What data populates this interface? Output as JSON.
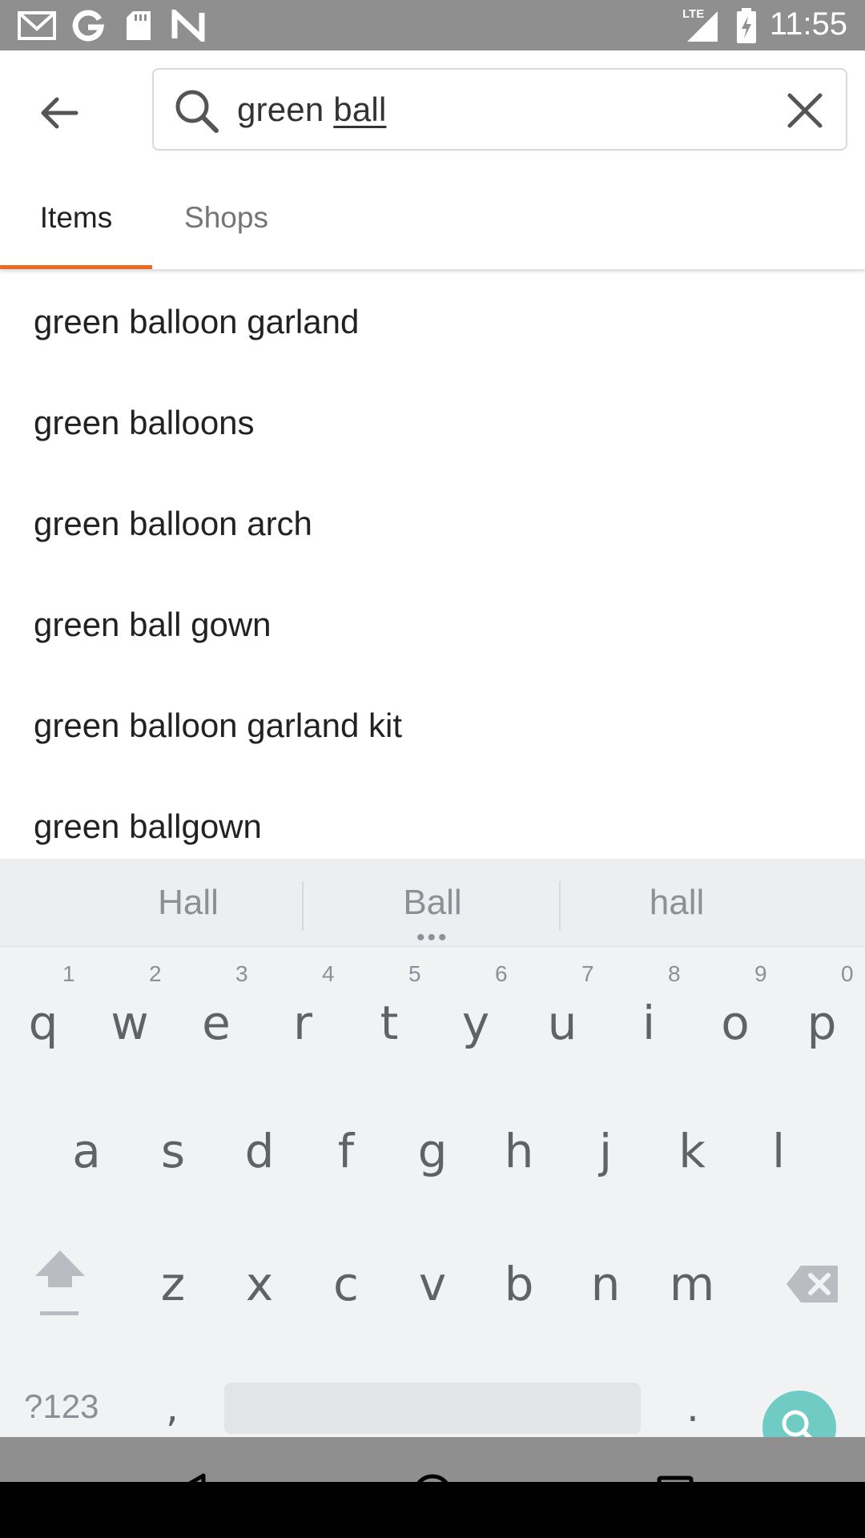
{
  "status_bar": {
    "time": "11:55",
    "network": "LTE",
    "left_icons": [
      "gmail-icon",
      "google-icon",
      "sd-card-icon",
      "n-app-icon"
    ],
    "right_icons": [
      "signal-icon",
      "battery-charging-icon"
    ]
  },
  "search": {
    "prefix": "green ",
    "typed_word": "ball"
  },
  "tabs": [
    {
      "label": "Items",
      "selected": true
    },
    {
      "label": "Shops",
      "selected": false
    }
  ],
  "suggestions": [
    "green balloon garland",
    "green balloons",
    "green balloon arch",
    "green ball gown",
    "green balloon garland kit",
    "green ballgown"
  ],
  "keyboard": {
    "suggestions": [
      "Hall",
      "Ball",
      "hall"
    ],
    "row1": [
      "q",
      "w",
      "e",
      "r",
      "t",
      "y",
      "u",
      "i",
      "o",
      "p"
    ],
    "row1_hints": [
      "1",
      "2",
      "3",
      "4",
      "5",
      "6",
      "7",
      "8",
      "9",
      "0"
    ],
    "row2": [
      "a",
      "s",
      "d",
      "f",
      "g",
      "h",
      "j",
      "k",
      "l"
    ],
    "row3": [
      "z",
      "x",
      "c",
      "v",
      "b",
      "n",
      "m"
    ],
    "symbols_key": "?123",
    "comma_key": ",",
    "period_key": "."
  },
  "colors": {
    "accent": "#e96b1f",
    "status_bar": "#8f8f8f",
    "keyboard_bg": "#f1f2f4",
    "search_fab": "#6fcbc4"
  }
}
